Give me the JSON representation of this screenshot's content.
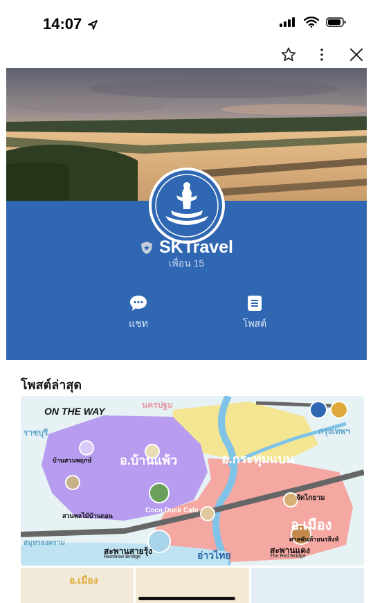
{
  "status": {
    "time": "14:07"
  },
  "colors": {
    "profile_band": "#2f67b3",
    "purple_region": "#b79cf0",
    "yellow_region": "#f3e592",
    "pink_region": "#f5a7a1",
    "river": "#7fc3e8"
  },
  "toolbar": {
    "star_icon": "star-icon",
    "more_icon": "more-vertical-icon",
    "close_icon": "close-icon"
  },
  "profile": {
    "name": "SKTravel",
    "friends": "เพื่อน 15",
    "badge_icon": "shield-star-icon"
  },
  "actions": [
    {
      "label": "แชท",
      "icon": "chat-bubble-icon"
    },
    {
      "label": "โพสต์",
      "icon": "post-list-icon"
    }
  ],
  "feed": {
    "section_title": "โพสต์ล่าสุด",
    "map": {
      "banner": "ON THE WAY",
      "districts": [
        "อ.บ้านแพ้ว",
        "อ.กระทุ่มแบน",
        "อ.เมือง"
      ],
      "neighbors": [
        "นครปฐม",
        "ราชบุรี",
        "กรุงเทพฯ",
        "สมุทรสงคราม"
      ],
      "places": [
        "Coco Duck Cafe",
        "สะพานสายรุ้ง",
        "อ่าวไทย",
        "สะพานแดง",
        "ศาลพันท้ายนรสิงห์",
        "จัดไกยาม",
        "บ้านสวนพฤกษ์",
        "สวนพลไม้บ้านดอน"
      ],
      "places_en": [
        "Rainbow Bridge",
        "The Red Bridge"
      ]
    },
    "thumbs": [
      {
        "label": "อ.เมือง"
      },
      {
        "label": ""
      },
      {
        "label": ""
      }
    ]
  }
}
